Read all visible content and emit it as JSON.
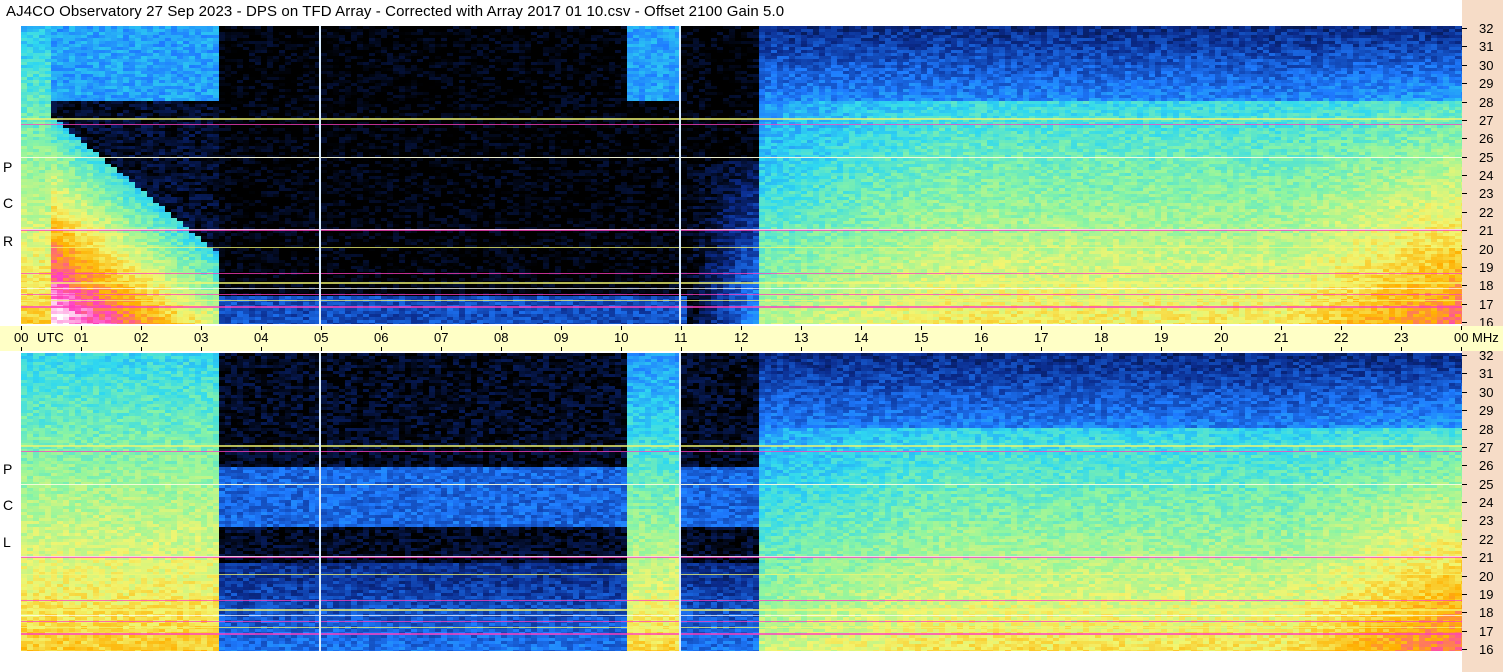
{
  "title": "AJ4CO Observatory  27 Sep 2023  -  DPS on TFD Array  -  Corrected with Array 2017 01 10.csv  -  Offset 2100  Gain 5.0",
  "chart_data": [
    {
      "type": "heatmap",
      "panel_label": [
        "R",
        "C",
        "P"
      ],
      "x_tick_labels": [
        "00",
        "01",
        "02",
        "03",
        "04",
        "05",
        "06",
        "07",
        "08",
        "09",
        "10",
        "11",
        "12",
        "13",
        "14",
        "15",
        "16",
        "17",
        "18",
        "19",
        "20",
        "21",
        "22",
        "23",
        "00"
      ],
      "x_unit": "UTC",
      "y_unit": "MHz",
      "y_tick_labels": [
        "16",
        "17",
        "18",
        "19",
        "20",
        "21",
        "22",
        "23",
        "24",
        "25",
        "26",
        "27",
        "28",
        "29",
        "30",
        "31",
        "32"
      ],
      "xlim": [
        0,
        24
      ],
      "ylim": [
        16,
        32
      ],
      "colormap": [
        "#000000",
        "#0a2a8a",
        "#1e7bff",
        "#2fd8f0",
        "#8ff5a0",
        "#f2f570",
        "#ffb000",
        "#ff3fbf",
        "#ffffff"
      ]
    },
    {
      "type": "heatmap",
      "panel_label": [
        "L",
        "C",
        "P"
      ],
      "x_tick_labels": [
        "00",
        "01",
        "02",
        "03",
        "04",
        "05",
        "06",
        "07",
        "08",
        "09",
        "10",
        "11",
        "12",
        "13",
        "14",
        "15",
        "16",
        "17",
        "18",
        "19",
        "20",
        "21",
        "22",
        "23",
        "00"
      ],
      "x_unit": "UTC",
      "y_unit": "MHz",
      "y_tick_labels": [
        "16",
        "17",
        "18",
        "19",
        "20",
        "21",
        "22",
        "23",
        "24",
        "25",
        "26",
        "27",
        "28",
        "29",
        "30",
        "31",
        "32"
      ],
      "xlim": [
        0,
        24
      ],
      "ylim": [
        16,
        32
      ],
      "colormap": [
        "#000000",
        "#0a2a8a",
        "#1e7bff",
        "#2fd8f0",
        "#8ff5a0",
        "#f2f570",
        "#ffb000",
        "#ff3fbf",
        "#ffffff"
      ]
    }
  ]
}
